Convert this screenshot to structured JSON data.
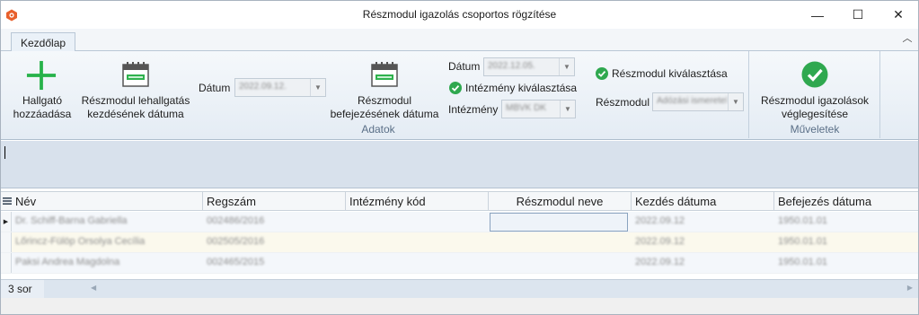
{
  "window": {
    "title": "Részmodul igazolás csoportos rögzítése",
    "minimize": "—",
    "maximize": "☐",
    "close": "✕"
  },
  "ribbon_tabs": [
    {
      "label": "Kezdőlap",
      "active": true
    }
  ],
  "ribbon": {
    "add_student": {
      "label_line1": "Hallgató",
      "label_line2": "hozzáadása",
      "icon": "plus-icon"
    },
    "start_date_btn": {
      "label_line1": "Részmodul lehallgatás",
      "label_line2": "kezdésének dátuma",
      "icon": "calendar-icon"
    },
    "start_date_field": {
      "label": "Dátum",
      "value": "2022.09.12."
    },
    "end_date_btn": {
      "label_line1": "Részmodul",
      "label_line2": "befejezésének dátuma",
      "icon": "calendar-icon"
    },
    "end_date_field": {
      "label": "Dátum",
      "value": "2022.12.05."
    },
    "institution_check": {
      "label": "Intézmény kiválasztása",
      "icon": "check-circle-icon"
    },
    "institution_field": {
      "label": "Intézmény",
      "value": "MBVK DK"
    },
    "module_check": {
      "label": "Részmodul kiválasztása",
      "icon": "check-circle-icon"
    },
    "module_field": {
      "label": "Részmodul",
      "value": "Adózási ismeretek"
    },
    "finalize": {
      "label_line1": "Részmodul igazolások",
      "label_line2": "véglegesítése",
      "icon": "check-circle-icon"
    },
    "groups": {
      "data": "Adatok",
      "actions": "Műveletek"
    }
  },
  "grid": {
    "columns": [
      "Név",
      "Regszám",
      "Intézmény kód",
      "Részmodul neve",
      "Kezdés dátuma",
      "Befejezés dátuma"
    ],
    "rows": [
      {
        "name": "Dr. Schiff-Barna Gabriella",
        "reg": "002486/2016",
        "inst": "",
        "module": "",
        "start": "2022.09.12",
        "end": "1950.01.01",
        "current": true
      },
      {
        "name": "Lőrincz-Fülöp Orsolya Cecília",
        "reg": "002505/2016",
        "inst": "",
        "module": "",
        "start": "2022.09.12",
        "end": "1950.01.01",
        "current": false
      },
      {
        "name": "Paksi Andrea Magdolna",
        "reg": "002465/2015",
        "inst": "",
        "module": "",
        "start": "2022.09.12",
        "end": "1950.01.01",
        "current": false
      }
    ]
  },
  "status": {
    "row_count": "3 sor"
  },
  "colors": {
    "accent_green": "#2fa84f",
    "add_green": "#27b24a",
    "app_icon": "#e8602c"
  }
}
